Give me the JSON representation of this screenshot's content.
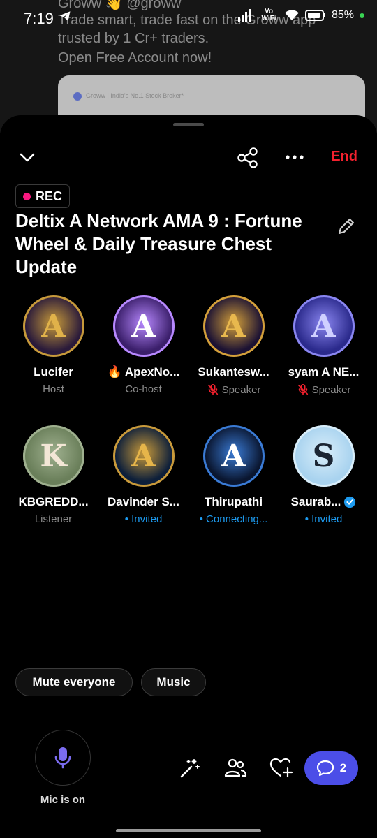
{
  "status_bar": {
    "time": "7:19",
    "network": "Vo WiFi",
    "battery": "85%"
  },
  "background_app": {
    "line1": "Groww 👋 @groww",
    "line2": "Trade smart, trade fast on the Groww app",
    "line3": "trusted by 1 Cr+ traders.",
    "line4": "Open Free Account now!",
    "card_brand": "Groww | India's No.1 Stock Broker*"
  },
  "header": {
    "end_label": "End"
  },
  "space": {
    "rec_label": "REC",
    "title": "Deltix A Network AMA 9 : Fortune Wheel & Daily Treasure Chest Update"
  },
  "participants": [
    {
      "name": "Lucifer",
      "role": "Host",
      "prefix": "",
      "muted": false,
      "verified": false,
      "avatar": {
        "bg": "#2a1a3a",
        "ring": "#c79a3a",
        "letter": "A",
        "letter_color": "#e0b24a"
      }
    },
    {
      "name": "ApexNo...",
      "role": "Co-host",
      "prefix": "🔥",
      "muted": false,
      "verified": false,
      "avatar": {
        "bg": "#3b1f6b",
        "ring": "#b889ff",
        "letter": "A",
        "letter_color": "#ffffff"
      }
    },
    {
      "name": "Sukantesw...",
      "role": "Speaker",
      "prefix": "",
      "muted": true,
      "verified": false,
      "avatar": {
        "bg": "#1c1233",
        "ring": "#d4a03a",
        "letter": "A",
        "letter_color": "#e8b84e"
      }
    },
    {
      "name": "syam A NE...",
      "role": "Speaker",
      "prefix": "",
      "muted": true,
      "verified": false,
      "avatar": {
        "bg": "#2b2a8c",
        "ring": "#8a86f0",
        "letter": "A",
        "letter_color": "#cfd0ff"
      }
    },
    {
      "name": "KBGREDD...",
      "role": "Listener",
      "prefix": "",
      "muted": false,
      "verified": false,
      "avatar": {
        "bg": "#6a7f5a",
        "ring": "#9fb08f",
        "letter": "K",
        "letter_color": "#f3e6d6"
      }
    },
    {
      "name": "Davinder S...",
      "role": "• Invited",
      "prefix": "",
      "muted": false,
      "verified": false,
      "avatar": {
        "bg": "#0d1f3a",
        "ring": "#c99a3a",
        "letter": "A",
        "letter_color": "#e6b54a"
      }
    },
    {
      "name": "Thirupathi",
      "role": "• Connecting...",
      "prefix": "",
      "muted": false,
      "verified": false,
      "avatar": {
        "bg": "#0a1630",
        "ring": "#3a7bd5",
        "letter": "A",
        "letter_color": "#ffffff"
      }
    },
    {
      "name": "Saurab...",
      "role": "• Invited",
      "prefix": "",
      "muted": false,
      "verified": true,
      "avatar": {
        "bg": "#a9d3ef",
        "ring": "#d9eefa",
        "letter": "S",
        "letter_color": "#1b2533"
      }
    }
  ],
  "controls": {
    "mute_everyone": "Mute everyone",
    "music": "Music",
    "mic_status": "Mic is on",
    "chat_count": "2"
  },
  "colors": {
    "end": "#f4212e",
    "rec_dot": "#f91880",
    "invited": "#1d9bf0",
    "chat_button": "#4b4ee8",
    "mic": "#7b6cf0"
  }
}
